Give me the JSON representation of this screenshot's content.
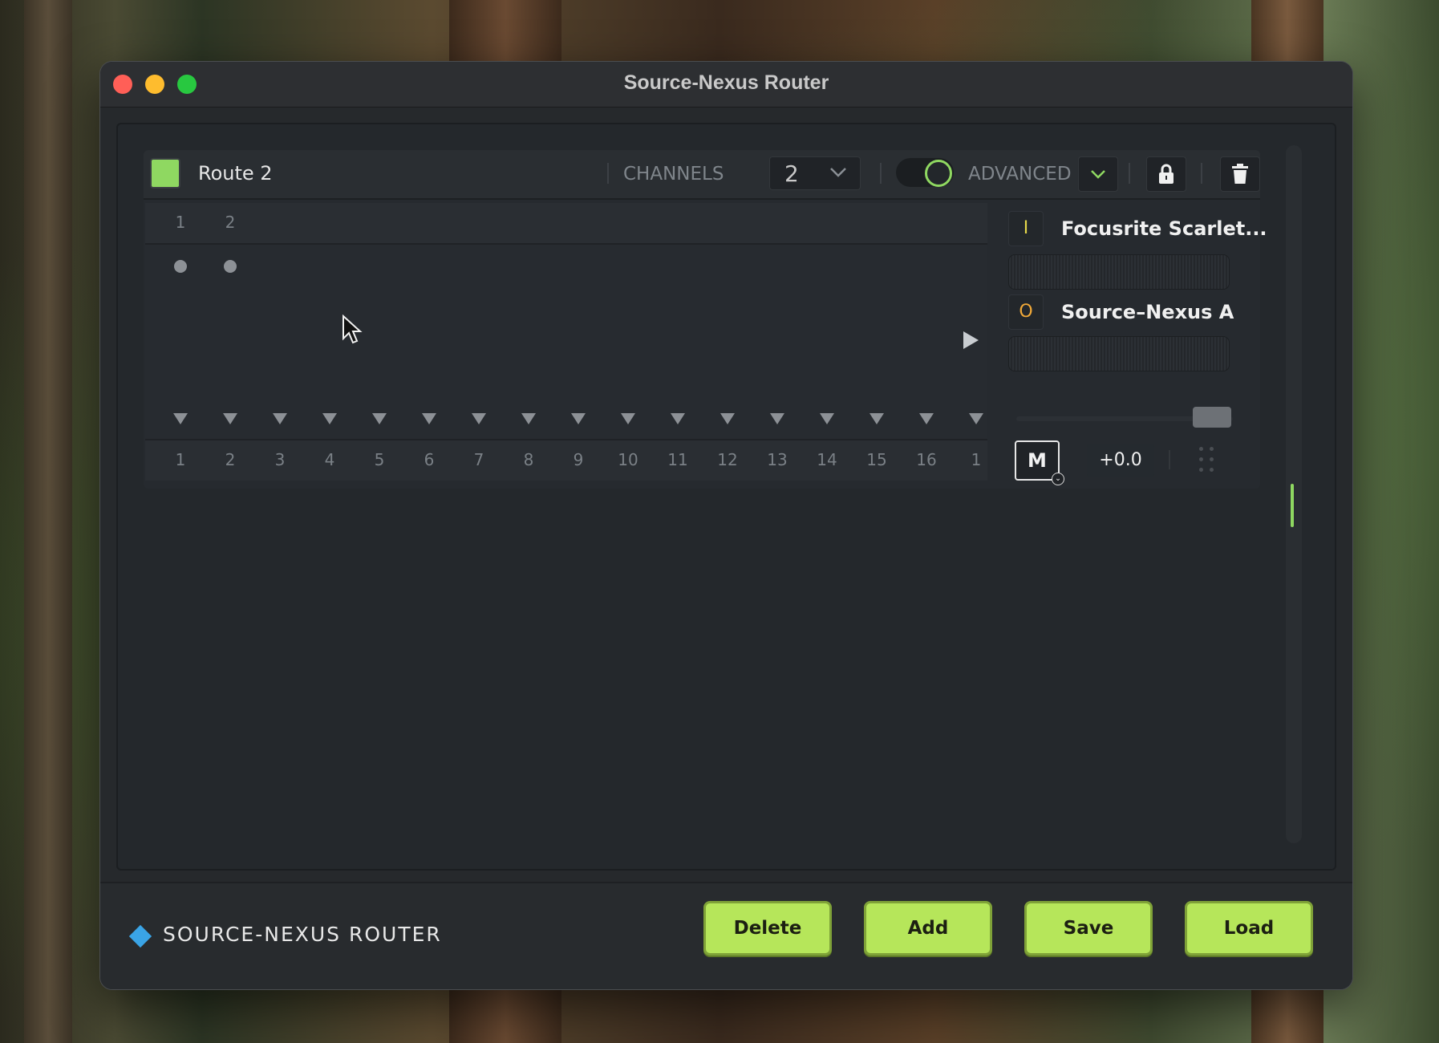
{
  "window": {
    "title": "Source-Nexus Router"
  },
  "route": {
    "name": "Route 2",
    "color": "#8fd861",
    "channels_label": "CHANNELS",
    "channels_value": "2",
    "advanced_label": "ADVANCED",
    "advanced_enabled": true
  },
  "matrix": {
    "top_channels": [
      "1",
      "2"
    ],
    "bottom_channels": [
      "1",
      "2",
      "3",
      "4",
      "5",
      "6",
      "7",
      "8",
      "9",
      "10",
      "11",
      "12",
      "13",
      "14",
      "15",
      "16",
      "1"
    ]
  },
  "devices": {
    "input": {
      "badge": "I",
      "name": "Focusrite Scarlet..."
    },
    "output": {
      "badge": "O",
      "name": "Source–Nexus A"
    }
  },
  "controls": {
    "mute_label": "M",
    "gain": "+0.0"
  },
  "footer": {
    "brand": "SOURCE-NEXUS ROUTER",
    "buttons": {
      "delete": "Delete",
      "add": "Add",
      "save": "Save",
      "load": "Load"
    }
  },
  "colors": {
    "accent": "#b6e65a",
    "route": "#8fd861",
    "brand": "#3aa4e6",
    "input_badge": "#e6d84a",
    "output_badge": "#f0a838"
  },
  "icons": {
    "lock": "lock-icon",
    "trash": "trash-icon",
    "chevron": "chevron-down-icon",
    "play": "play-icon",
    "cursor": "mouse-pointer-icon"
  }
}
